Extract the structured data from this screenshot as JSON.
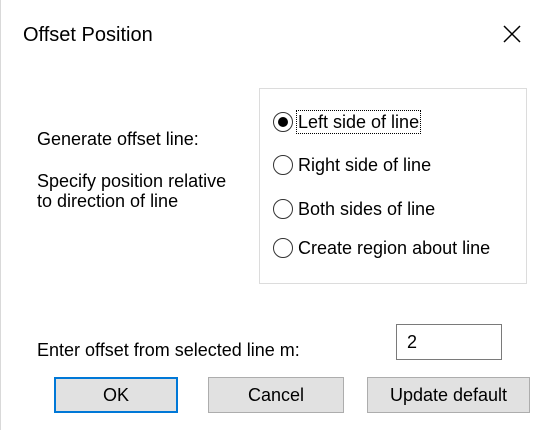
{
  "dialog": {
    "title": "Offset Position",
    "close_icon": "close-icon"
  },
  "labels": {
    "generate": "Generate offset line:",
    "specify": "Specify position relative to direction of line",
    "offset_prompt": "Enter offset from selected line m:"
  },
  "options": [
    {
      "label": "Left side of line",
      "checked": true
    },
    {
      "label": "Right side of line",
      "checked": false
    },
    {
      "label": "Both sides of line",
      "checked": false
    },
    {
      "label": "Create region about line",
      "checked": false
    }
  ],
  "offset": {
    "value": "2"
  },
  "buttons": {
    "ok": "OK",
    "cancel": "Cancel",
    "update_default": "Update default"
  },
  "colors": {
    "default_button_border": "#0078d7",
    "button_face": "#e1e1e1"
  }
}
